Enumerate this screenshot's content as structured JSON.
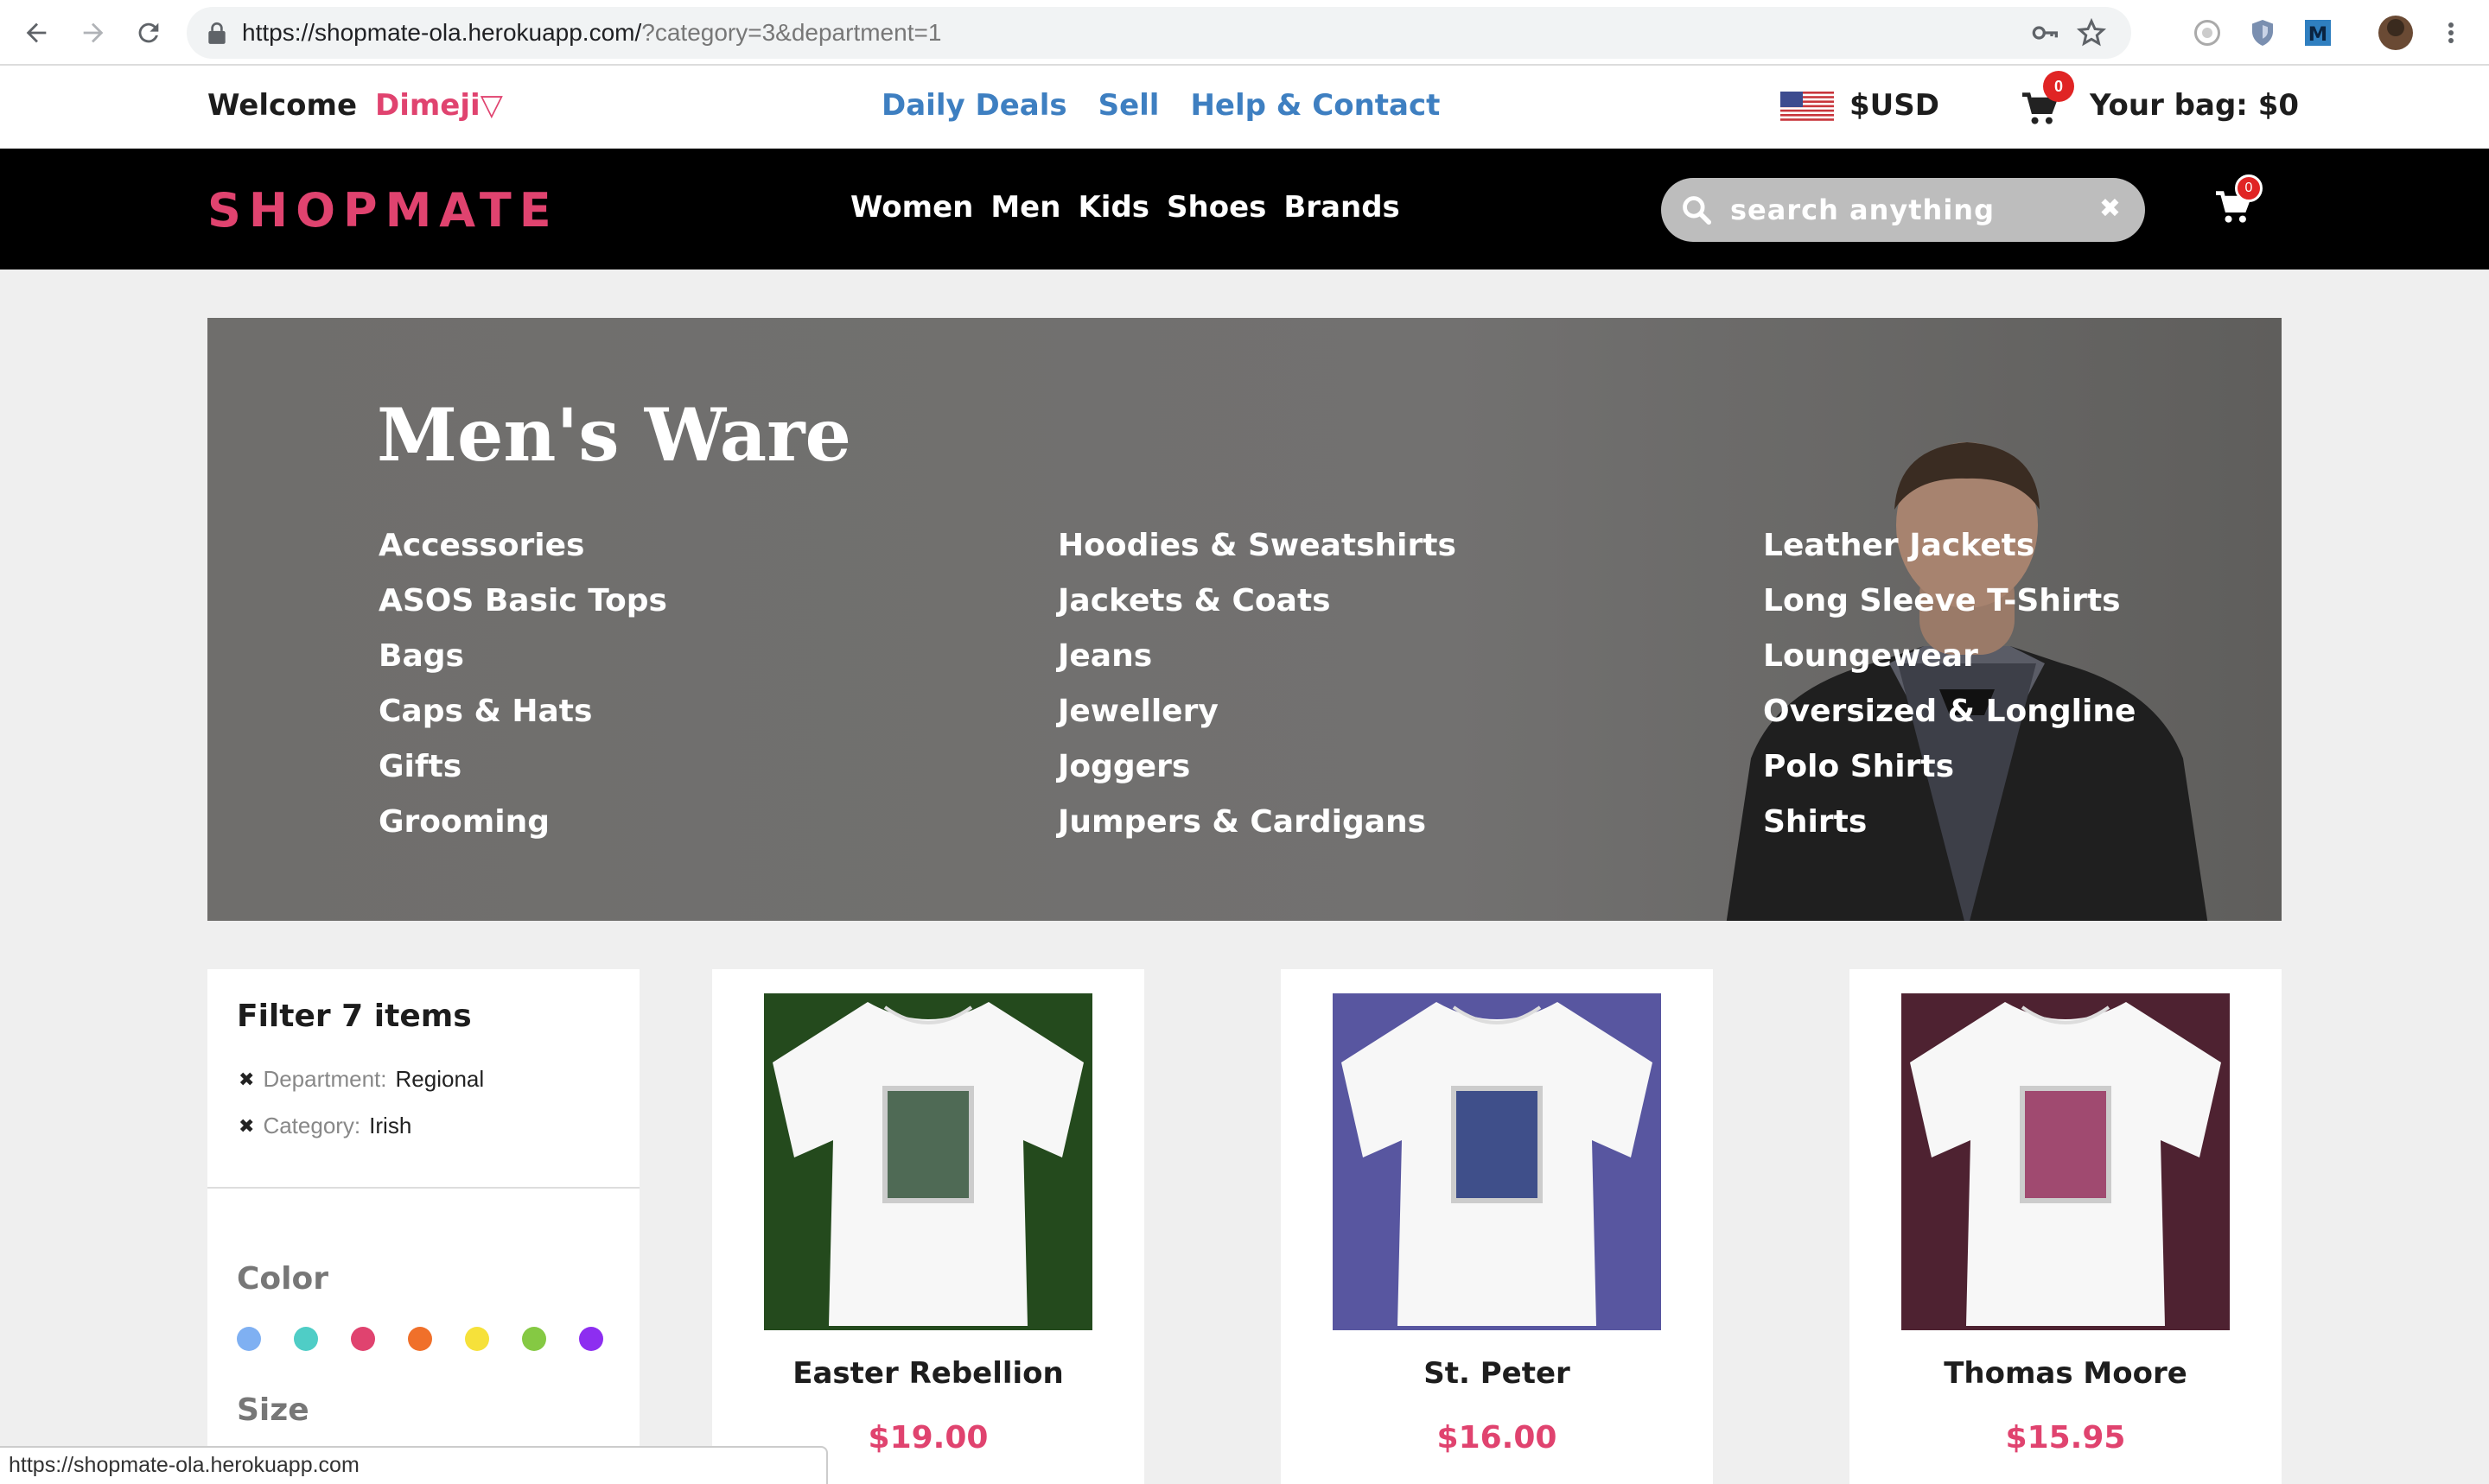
{
  "browser": {
    "url_main": "https://shopmate-ola.herokuapp.com/",
    "url_query": "?category=3&department=1"
  },
  "topbar": {
    "welcome": "Welcome",
    "username": "Dimeji",
    "links": [
      "Daily Deals",
      "Sell",
      "Help & Contact"
    ],
    "currency": "$USD",
    "cart_count": "0",
    "bag_label": "Your bag: $0"
  },
  "nav": {
    "logo": "SHOPMATE",
    "categories": [
      "Women",
      "Men",
      "Kids",
      "Shoes",
      "Brands"
    ],
    "search_placeholder": "search anything",
    "cart_count": "0"
  },
  "hero": {
    "title": "Men's Ware",
    "columns": [
      [
        "Accessories",
        "ASOS Basic Tops",
        "Bags",
        "Caps & Hats",
        "Gifts",
        "Grooming"
      ],
      [
        "Hoodies & Sweatshirts",
        "Jackets & Coats",
        "Jeans",
        "Jewellery",
        "Joggers",
        "Jumpers & Cardigans"
      ],
      [
        "Leather Jackets",
        "Long Sleeve T-Shirts",
        "Loungewear",
        "Oversized & Longline",
        "Polo Shirts",
        "Shirts"
      ]
    ]
  },
  "filter": {
    "title": "Filter 7 items",
    "chips": [
      {
        "key": "Department:",
        "value": "Regional"
      },
      {
        "key": "Category:",
        "value": "Irish"
      }
    ],
    "color_title": "Color",
    "colors": [
      "#7fb0f2",
      "#4fcdc6",
      "#e0436f",
      "#f0702a",
      "#f6e13a",
      "#85c943",
      "#8d2ef0"
    ],
    "size_title": "Size"
  },
  "products": [
    {
      "name": "Easter Rebellion",
      "price": "$19.00",
      "bg": "#244a1d",
      "stamp": "#4f6a55"
    },
    {
      "name": "St. Peter",
      "price": "$16.00",
      "bg": "#5856a0",
      "stamp": "#3f4f8a"
    },
    {
      "name": "Thomas Moore",
      "price": "$15.95",
      "bg": "#4e2231",
      "stamp": "#a04a70"
    }
  ],
  "status_bar": "https://shopmate-ola.herokuapp.com"
}
